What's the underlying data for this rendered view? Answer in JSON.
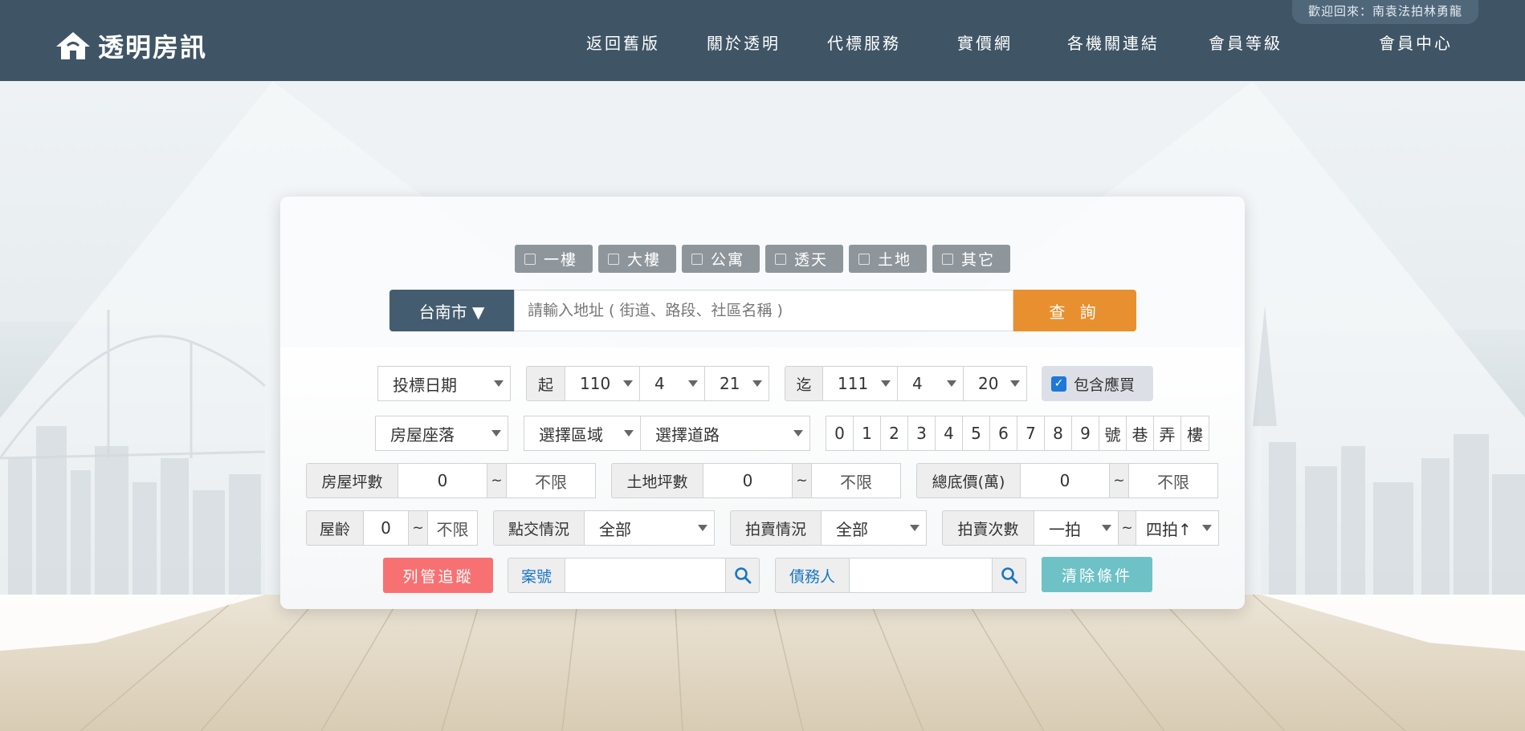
{
  "header": {
    "logo_text": "透明房訊",
    "welcome": "歡迎回來：南袁法拍林勇龍",
    "nav": [
      "返回舊版",
      "關於透明",
      "代標服務",
      "實價網",
      "各機關連結",
      "會員等級",
      "會員中心"
    ]
  },
  "property_types": [
    "一樓",
    "大樓",
    "公寓",
    "透天",
    "土地",
    "其它"
  ],
  "search": {
    "city": "台南市 ▼",
    "placeholder": "請輸入地址 ( 街道、路段、社區名稱 )",
    "query_label": "查 詢"
  },
  "date_filter": {
    "type": "投標日期",
    "from_label": "起",
    "from": {
      "year": "110",
      "month": "4",
      "day": "21"
    },
    "to_label": "迄",
    "to": {
      "year": "111",
      "month": "4",
      "day": "20"
    },
    "include_label": "包含應買"
  },
  "location": {
    "type": "房屋座落",
    "district": "選擇區域",
    "road": "選擇道路",
    "keys": [
      "0",
      "1",
      "2",
      "3",
      "4",
      "5",
      "6",
      "7",
      "8",
      "9",
      "號",
      "巷",
      "弄",
      "樓"
    ]
  },
  "ranges": {
    "house_ping": {
      "label": "房屋坪數",
      "min": "0",
      "max": "不限"
    },
    "land_ping": {
      "label": "土地坪數",
      "min": "0",
      "max": "不限"
    },
    "base_price": {
      "label": "總底價(萬)",
      "min": "0",
      "max": "不限"
    },
    "age": {
      "label": "屋齡",
      "min": "0",
      "max": "不限"
    },
    "tilde": "~"
  },
  "status": {
    "handover": {
      "label": "點交情況",
      "value": "全部"
    },
    "auction": {
      "label": "拍賣情況",
      "value": "全部"
    },
    "count": {
      "label": "拍賣次數",
      "min": "一拍",
      "max": "四拍↑"
    }
  },
  "actions": {
    "track": "列管追蹤",
    "case_label": "案號",
    "debtor_label": "債務人",
    "clear": "清除條件"
  },
  "colors": {
    "header_bg": "#3f5566",
    "query_orange": "#e8902f",
    "track_red": "#f87172",
    "clear_teal": "#6ec2c6",
    "city_blue": "#445c6f"
  }
}
